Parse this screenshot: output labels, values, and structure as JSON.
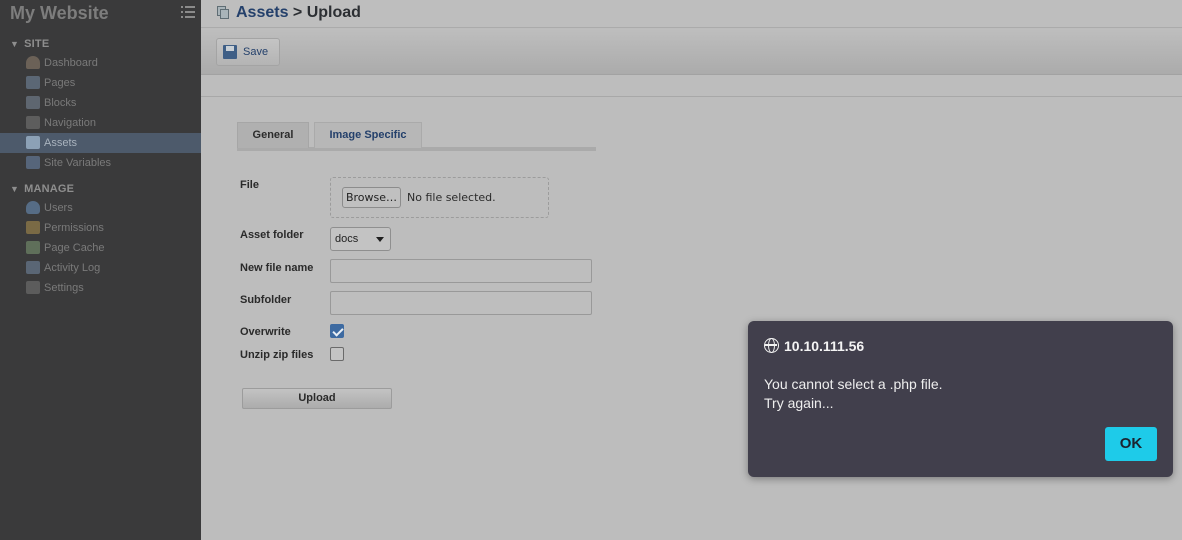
{
  "sidebar": {
    "site_title": "My Website",
    "sections": [
      {
        "title": "SITE",
        "items": [
          {
            "label": "Dashboard",
            "icon": "dashboard-icon"
          },
          {
            "label": "Pages",
            "icon": "pages-icon"
          },
          {
            "label": "Blocks",
            "icon": "blocks-icon"
          },
          {
            "label": "Navigation",
            "icon": "navigation-icon"
          },
          {
            "label": "Assets",
            "icon": "assets-icon",
            "active": true
          },
          {
            "label": "Site Variables",
            "icon": "site-variables-icon"
          }
        ]
      },
      {
        "title": "MANAGE",
        "items": [
          {
            "label": "Users",
            "icon": "user-icon"
          },
          {
            "label": "Permissions",
            "icon": "key-icon"
          },
          {
            "label": "Page Cache",
            "icon": "page-cache-icon"
          },
          {
            "label": "Activity Log",
            "icon": "book-icon"
          },
          {
            "label": "Settings",
            "icon": "settings-icon"
          }
        ]
      }
    ]
  },
  "header": {
    "crumb_link": "Assets",
    "crumb_rest": " > Upload"
  },
  "toolbar": {
    "save_label": "Save"
  },
  "tabs": [
    {
      "label": "General",
      "active": true
    },
    {
      "label": "Image Specific"
    }
  ],
  "form": {
    "file_label": "File",
    "browse_label": "Browse…",
    "no_file_text": "No file selected.",
    "asset_folder_label": "Asset folder",
    "asset_folder_value": "docs",
    "new_file_name_label": "New file name",
    "new_file_name_value": "",
    "subfolder_label": "Subfolder",
    "subfolder_value": "",
    "overwrite_label": "Overwrite",
    "overwrite_checked": true,
    "unzip_label": "Unzip zip files",
    "unzip_checked": false,
    "upload_label": "Upload"
  },
  "dialog": {
    "title": "10.10.111.56",
    "message_line1": "You cannot select a .php file.",
    "message_line2": "Try again...",
    "ok_label": "OK",
    "accent_color": "#1ecbe9"
  }
}
